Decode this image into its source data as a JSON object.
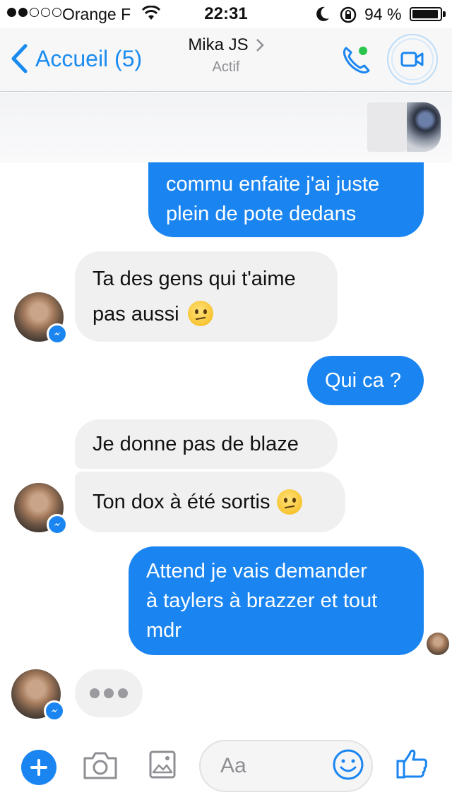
{
  "status_bar": {
    "carrier": "Orange F",
    "time": "22:31",
    "battery": "94 %"
  },
  "nav": {
    "back_label": "Accueil (5)",
    "contact_name": "Mika JS",
    "contact_status": "Actif"
  },
  "messages": [
    {
      "sender": "me",
      "text_line1": "commu enfaite j'ai juste",
      "text_line2": "plein de pote dedans"
    },
    {
      "sender": "them",
      "text_line1": "Ta des gens qui t'aime",
      "text_line2": "pas aussi"
    },
    {
      "sender": "me",
      "text": "Qui ca ?"
    },
    {
      "sender": "them",
      "text": "Je donne pas de blaze"
    },
    {
      "sender": "them",
      "text": "Ton dox à été sortis"
    },
    {
      "sender": "me",
      "text_line1": "Attend je vais demander",
      "text_line2": "à taylers à brazzer et tout",
      "text_line3": "mdr"
    }
  ],
  "composer": {
    "placeholder": "Aa"
  },
  "colors": {
    "accent": "#1a85f0",
    "incoming_bubble": "#f0f0f1",
    "online_dot": "#2bc44c"
  },
  "icons": [
    "wifi-icon",
    "moon-icon",
    "rotation-lock-icon",
    "battery-icon",
    "back-chevron-icon",
    "chevron-right-icon",
    "phone-icon",
    "video-camera-icon",
    "messenger-badge-icon",
    "plus-icon",
    "camera-icon",
    "image-icon",
    "smiley-icon",
    "thumbs-up-icon"
  ]
}
